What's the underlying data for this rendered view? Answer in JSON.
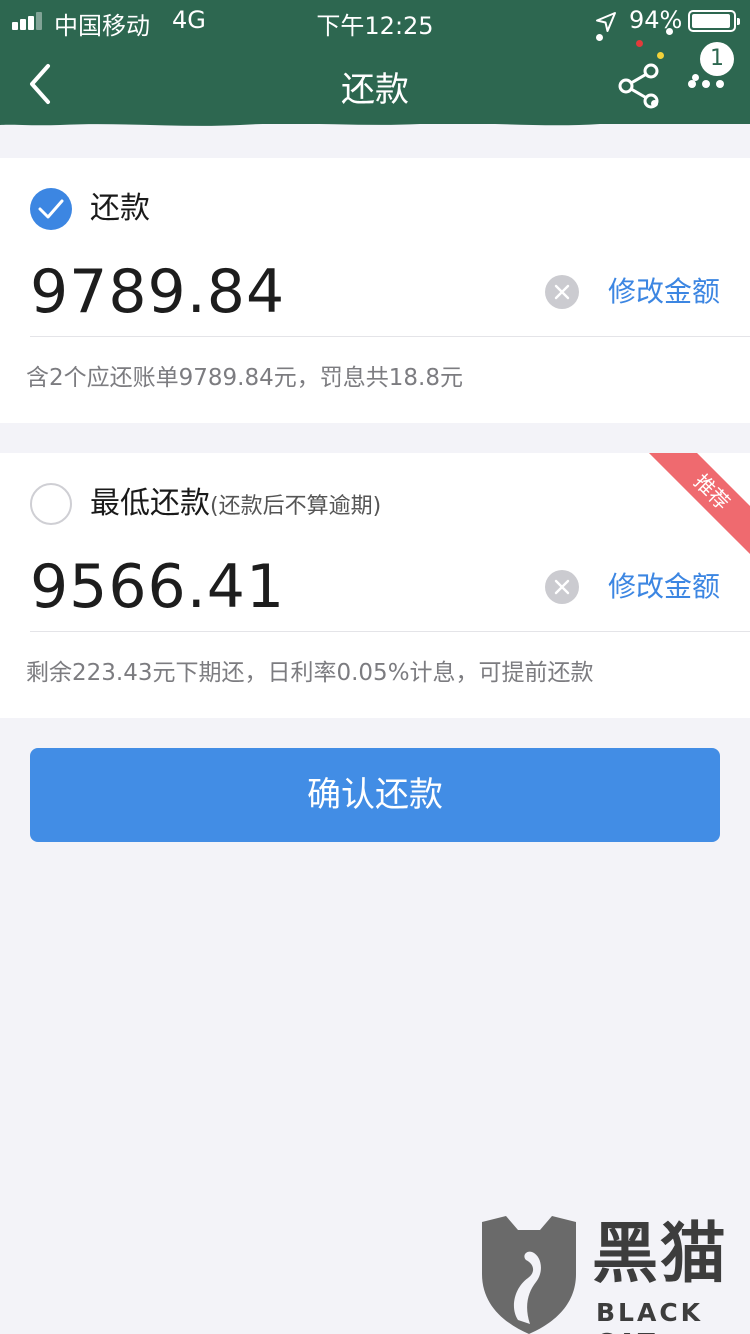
{
  "status_bar": {
    "carrier": "中国移动",
    "network": "4G",
    "time": "下午12:25",
    "battery": "94%",
    "battery_level": 0.94
  },
  "nav": {
    "title": "还款",
    "badge_count": "1",
    "icons": [
      "back-chevron-icon",
      "share-icon",
      "more-icon"
    ]
  },
  "options": [
    {
      "label": "还款",
      "note": "",
      "selected": true,
      "amount": "9789.84",
      "edit_label": "修改金额",
      "detail": "含2个应还账单9789.84元，罚息共18.8元"
    },
    {
      "label": "最低还款",
      "note": "(还款后不算逾期)",
      "selected": false,
      "amount": "9566.41",
      "edit_label": "修改金额",
      "detail": "剩余223.43元下期还，日利率0.05%计息，可提前还款",
      "ribbon": "推荐"
    }
  ],
  "confirm_button": "确认还款",
  "watermark": {
    "cn": "黑猫",
    "en": "BLACK CAT"
  },
  "colors": {
    "header": "#2d6750",
    "accent": "#3c86e2",
    "button": "#428de5",
    "ribbon": "#ef6a6f",
    "background": "#f3f3f8"
  }
}
